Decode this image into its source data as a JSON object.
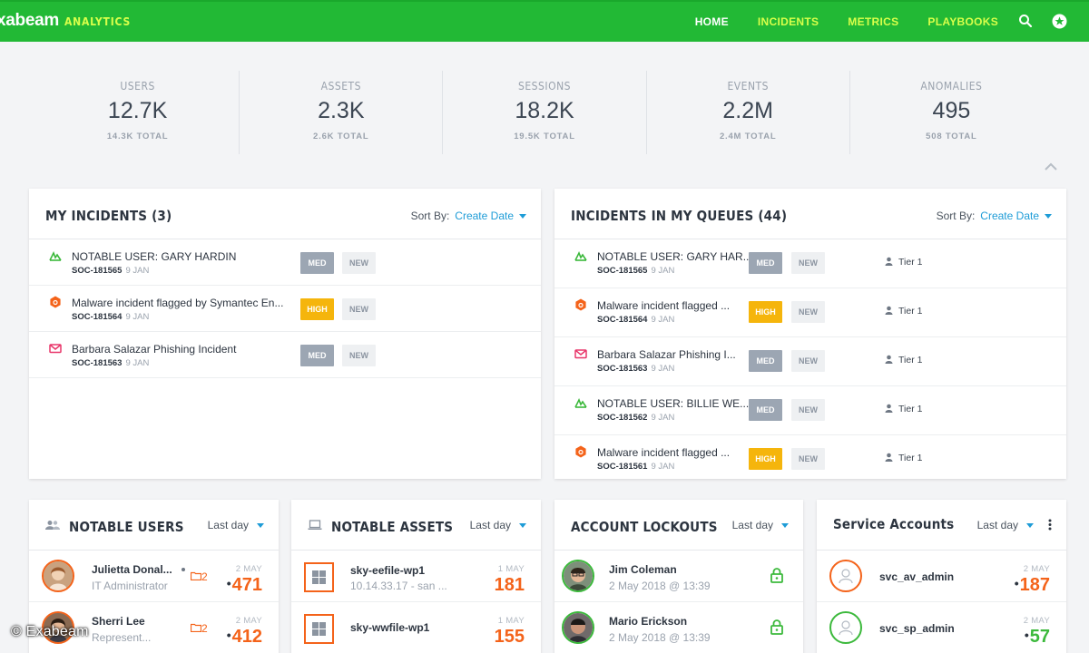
{
  "nav": {
    "brand": "xabeam",
    "brand_sub": "ANALYTICS",
    "links": [
      {
        "label": "HOME",
        "active": true
      },
      {
        "label": "INCIDENTS",
        "active": false
      },
      {
        "label": "METRICS",
        "active": false
      },
      {
        "label": "PLAYBOOKS",
        "active": false
      }
    ],
    "icons": [
      "search-icon",
      "profile-icon"
    ]
  },
  "stats": [
    {
      "label": "USERS",
      "value": "12.7K",
      "total": "14.3K TOTAL"
    },
    {
      "label": "ASSETS",
      "value": "2.3K",
      "total": "2.6K TOTAL"
    },
    {
      "label": "SESSIONS",
      "value": "18.2K",
      "total": "19.5K TOTAL"
    },
    {
      "label": "EVENTS",
      "value": "2.2M",
      "total": "2.4M TOTAL"
    },
    {
      "label": "ANOMALIES",
      "value": "495",
      "total": "508 TOTAL"
    }
  ],
  "my_incidents": {
    "title": "MY INCIDENTS (3)",
    "sort_label": "Sort By:",
    "sort_value": "Create Date",
    "rows": [
      {
        "icon": "notable-user-icon",
        "title": "NOTABLE USER: GARY HARDIN",
        "id": "SOC-181565",
        "date": "9 JAN",
        "severity": "MED",
        "status": "NEW"
      },
      {
        "icon": "malware-bug-icon",
        "title": "Malware incident flagged by Symantec En...",
        "id": "SOC-181564",
        "date": "9 JAN",
        "severity": "HIGH",
        "status": "NEW"
      },
      {
        "icon": "phishing-mail-icon",
        "title": "Barbara Salazar Phishing Incident",
        "id": "SOC-181563",
        "date": "9 JAN",
        "severity": "MED",
        "status": "NEW"
      }
    ]
  },
  "queue_incidents": {
    "title": "INCIDENTS IN MY QUEUES (44)",
    "sort_label": "Sort By:",
    "sort_value": "Create Date",
    "rows": [
      {
        "icon": "notable-user-icon",
        "title": "NOTABLE USER: GARY HAR...",
        "id": "SOC-181565",
        "date": "9 JAN",
        "severity": "MED",
        "status": "NEW",
        "queue": "Tier 1"
      },
      {
        "icon": "malware-bug-icon",
        "title": "Malware incident flagged ...",
        "id": "SOC-181564",
        "date": "9 JAN",
        "severity": "HIGH",
        "status": "NEW",
        "queue": "Tier 1"
      },
      {
        "icon": "phishing-mail-icon",
        "title": "Barbara Salazar Phishing I...",
        "id": "SOC-181563",
        "date": "9 JAN",
        "severity": "MED",
        "status": "NEW",
        "queue": "Tier 1"
      },
      {
        "icon": "notable-user-icon",
        "title": "NOTABLE USER: BILLIE WE...",
        "id": "SOC-181562",
        "date": "9 JAN",
        "severity": "MED",
        "status": "NEW",
        "queue": "Tier 1"
      },
      {
        "icon": "malware-bug-icon",
        "title": "Malware incident flagged ...",
        "id": "SOC-181561",
        "date": "9 JAN",
        "severity": "HIGH",
        "status": "NEW",
        "queue": "Tier 1"
      }
    ]
  },
  "notable_users": {
    "title": "NOTABLE USERS",
    "period": "Last day",
    "rows": [
      {
        "name": "Julietta Donal...",
        "role": "IT Administrator",
        "count": "2",
        "date": "2 MAY",
        "score": "471"
      },
      {
        "name": "Sherri Lee",
        "role": "Represent...",
        "count": "2",
        "date": "2 MAY",
        "score": "412"
      }
    ]
  },
  "notable_assets": {
    "title": "NOTABLE ASSETS",
    "period": "Last day",
    "rows": [
      {
        "name": "sky-eefile-wp1",
        "detail": "10.14.33.17 - san ...",
        "date": "1 MAY",
        "score": "181"
      },
      {
        "name": "sky-wwfile-wp1",
        "detail": "",
        "date": "1 MAY",
        "score": "155"
      }
    ]
  },
  "account_lockouts": {
    "title": "ACCOUNT LOCKOUTS",
    "period": "Last day",
    "rows": [
      {
        "name": "Jim Coleman",
        "detail": "2 May 2018 @ 13:39"
      },
      {
        "name": "Mario Erickson",
        "detail": "2 May 2018 @ 13:39"
      }
    ]
  },
  "service_accounts": {
    "title": "Service Accounts",
    "period": "Last day",
    "rows": [
      {
        "name": "svc_av_admin",
        "date": "2 MAY",
        "score": "187",
        "color": "#f4631a"
      },
      {
        "name": "svc_sp_admin",
        "date": "2 MAY",
        "score": "57",
        "color": "#3cb93c"
      }
    ]
  },
  "watermark": "© Exabeam",
  "colors": {
    "nav": "#22b935",
    "accent": "#d8ff4a",
    "link": "#1e9cd7",
    "high": "#f5b50c",
    "med": "#9ca6b3",
    "orange": "#f4631a",
    "green": "#3cb93c"
  }
}
